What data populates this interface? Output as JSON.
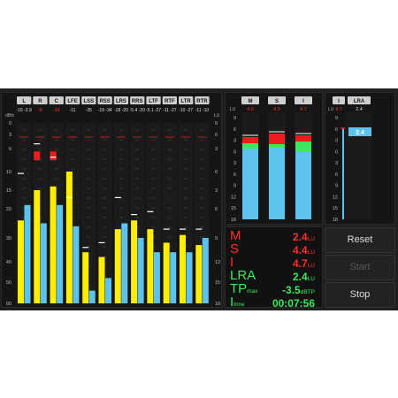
{
  "channels": [
    {
      "label": "L",
      "readout": "-16 -3.9",
      "readout_red": false,
      "yellow": 24,
      "blue": 19,
      "peak_red": "",
      "peak_white": -10.5
    },
    {
      "label": "R",
      "readout": "-8",
      "readout_red": false,
      "readout2": "-3.9",
      "yellow": 15,
      "blue": 25,
      "peak_red": "red",
      "peak_white": -5
    },
    {
      "label": "C",
      "readout": "-10",
      "readout_red": false,
      "readout2": "-3.9",
      "yellow": 14,
      "blue": 19,
      "peak_red": "red",
      "peak_white": -7.5
    },
    {
      "label": "LFE",
      "readout": "-11",
      "readout_red": false,
      "yellow": 10,
      "blue": 26,
      "peak_red": "",
      "peak_white": -17
    },
    {
      "label": "LSS",
      "readout": "-35",
      "readout_red": false,
      "yellow": 36,
      "blue": 54,
      "peak_red": "",
      "peak_white": -34
    },
    {
      "label": "RSS",
      "readout": "-19 -34",
      "readout_red": false,
      "yellow": 38,
      "blue": 48,
      "peak_red": "",
      "peak_white": -32
    },
    {
      "label": "LRS",
      "readout": "-18 -20",
      "readout_red": false,
      "yellow": 27,
      "blue": 25,
      "peak_red": "",
      "peak_white": -17
    },
    {
      "label": "RRS",
      "readout": "-5.4 -20",
      "readout_red": false,
      "yellow": 24,
      "blue": 30,
      "peak_red": "",
      "peak_white": -22
    },
    {
      "label": "LTF",
      "readout": "-5.1 -27",
      "readout_red": false,
      "yellow": 27,
      "blue": 36,
      "peak_red": "",
      "peak_white": -21
    },
    {
      "label": "RTF",
      "readout": "-11 -27",
      "readout_red": false,
      "yellow": 32,
      "blue": 36,
      "peak_red": "",
      "peak_white": -27
    },
    {
      "label": "LTR",
      "readout": "-10 -27",
      "readout_red": false,
      "yellow": 29,
      "blue": 36,
      "peak_red": "",
      "peak_white": -27
    },
    {
      "label": "RTR",
      "readout": "-11 -10",
      "readout_red": false,
      "yellow": 33,
      "blue": 30,
      "peak_red": "",
      "peak_white": -27
    }
  ],
  "left_scale": {
    "unit": "dBfs",
    "ticks": [
      "0",
      "3",
      "6",
      "10",
      "15",
      "20",
      "30",
      "40",
      "50",
      "60"
    ]
  },
  "right_scale": {
    "unit": "LU",
    "ticks": [
      "9",
      "6",
      "3",
      "0",
      "3",
      "6",
      "9",
      "12",
      "15",
      "18"
    ]
  },
  "loudness_meters": [
    {
      "label": "M",
      "readout": "4.0"
    },
    {
      "label": "S",
      "readout": "4.5"
    },
    {
      "label": "I",
      "readout": "4.7"
    }
  ],
  "loudness_scale": {
    "unit": "LU",
    "ticks": [
      "9",
      "6",
      "3",
      "0",
      "3",
      "6",
      "9",
      "12",
      "15",
      "18"
    ]
  },
  "lra_panel": {
    "i_label": "I",
    "i_readout": "4.7",
    "lra_label": "LRA",
    "lra_readout": "2.4",
    "lra_box_value": "2.4",
    "unit": "LU",
    "ticks": [
      "9",
      "6",
      "3",
      "0",
      "3",
      "6",
      "9",
      "12",
      "15",
      "18"
    ]
  },
  "stats": [
    {
      "label": "M",
      "sub": "",
      "value": "2.4",
      "unit": "LU",
      "color": "#ff2e2e"
    },
    {
      "label": "S",
      "sub": "",
      "value": "4.4",
      "unit": "LU",
      "color": "#ff2e2e"
    },
    {
      "label": "I",
      "sub": "",
      "value": "4.7",
      "unit": "LU",
      "color": "#ff2e2e"
    },
    {
      "label": "LRA",
      "sub": "",
      "value": "2.4",
      "unit": "LU",
      "color": "#3be85a"
    },
    {
      "label": "TP",
      "sub": "max",
      "value": "-3.5",
      "unit": "dBTP",
      "color": "#3be85a"
    },
    {
      "label": "I",
      "sub": "time",
      "value": "00:07:56",
      "unit": "",
      "color": "#3be85a"
    }
  ],
  "buttons": {
    "reset": "Reset",
    "start": "Start",
    "stop": "Stop"
  },
  "colors": {
    "yellow": "#ffee00",
    "blue": "#5cc3ee",
    "red": "#ee1c1c",
    "green": "#3be85a"
  }
}
